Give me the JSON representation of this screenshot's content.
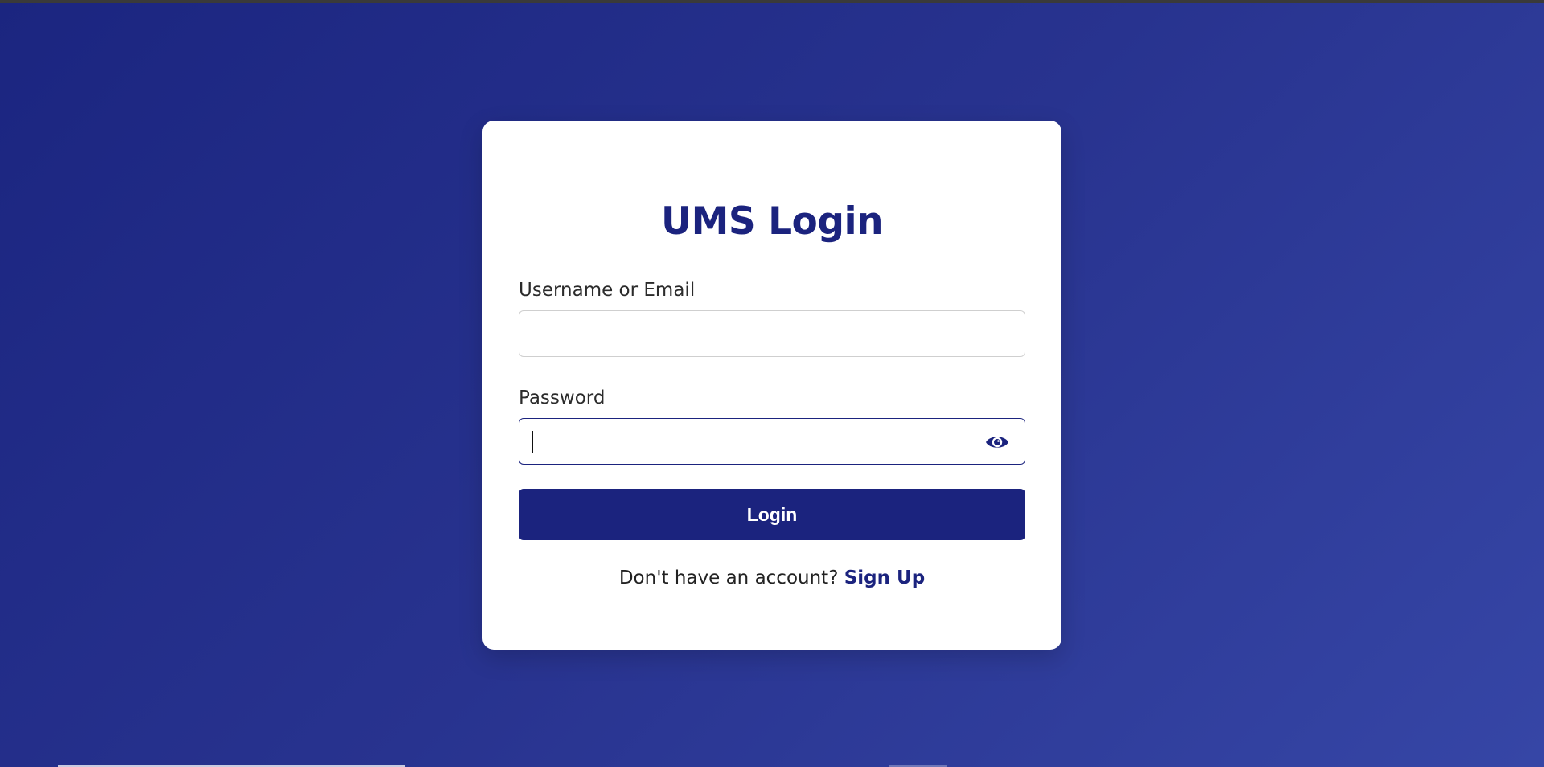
{
  "login": {
    "title": "UMS Login",
    "username_label": "Username or Email",
    "username_value": "",
    "password_label": "Password",
    "password_value": "",
    "submit_label": "Login",
    "signup_prompt": "Don't have an account? ",
    "signup_link": "Sign Up"
  },
  "icons": {
    "password_toggle": "eye-icon"
  },
  "colors": {
    "background_start": "#1b2580",
    "background_end": "#3646a6",
    "brand": "#1b237e",
    "card": "#ffffff"
  }
}
